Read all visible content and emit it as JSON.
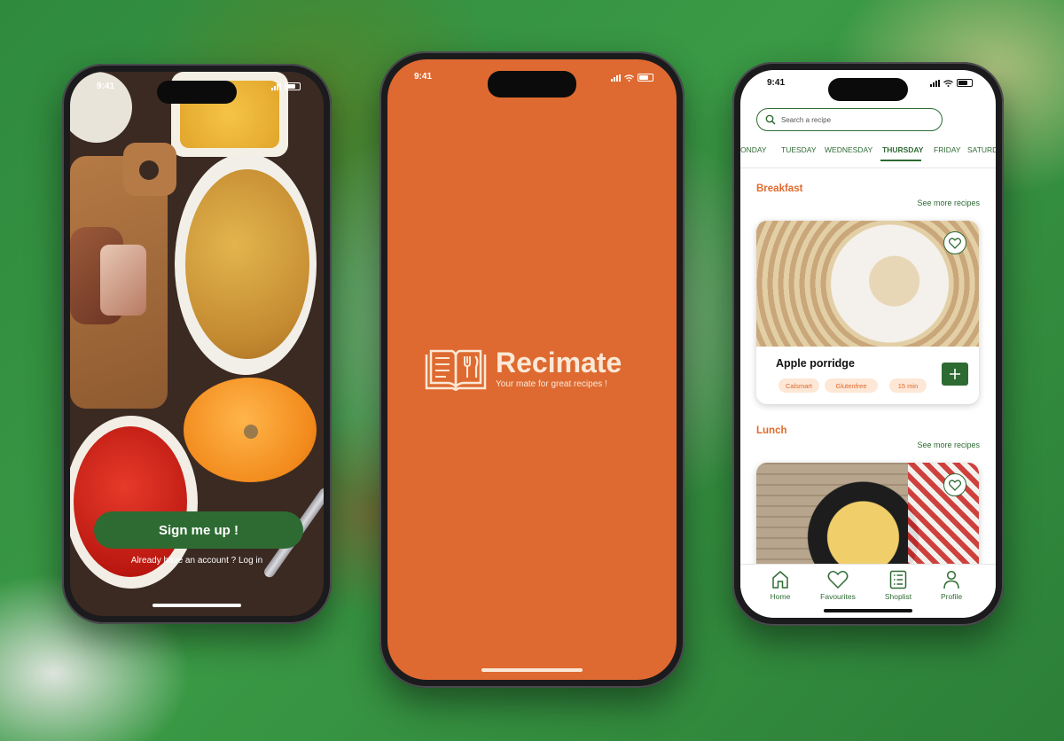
{
  "status": {
    "time": "9:41"
  },
  "welcome": {
    "signup_label": "Sign me up !",
    "login_prompt": "Already have an account ? Log in"
  },
  "splash": {
    "brand": "Recimate",
    "tagline": "Your mate for great recipes !",
    "background_color": "#de6a31"
  },
  "home": {
    "search_placeholder": "Search a recipe",
    "days": [
      "ONDAY",
      "TUESDAY",
      "WEDNESDAY",
      "THURSDAY",
      "FRIDAY",
      "SATURDAY"
    ],
    "active_day": "THURSDAY",
    "sections": [
      {
        "title": "Breakfast",
        "see_more": "See more recipes",
        "recipe": {
          "name": "Apple porridge",
          "tags": [
            "Calsmart",
            "Glutenfree",
            "15 min"
          ]
        }
      },
      {
        "title": "Lunch",
        "see_more": "See more recipes"
      }
    ],
    "tabbar": [
      {
        "label": "Home",
        "icon": "home-icon"
      },
      {
        "label": "Favourites",
        "icon": "heart-icon"
      },
      {
        "label": "Shoplist",
        "icon": "list-icon"
      },
      {
        "label": "Profile",
        "icon": "person-icon"
      }
    ]
  },
  "colors": {
    "accent_green": "#2e6b33",
    "accent_orange": "#e06a2b"
  }
}
